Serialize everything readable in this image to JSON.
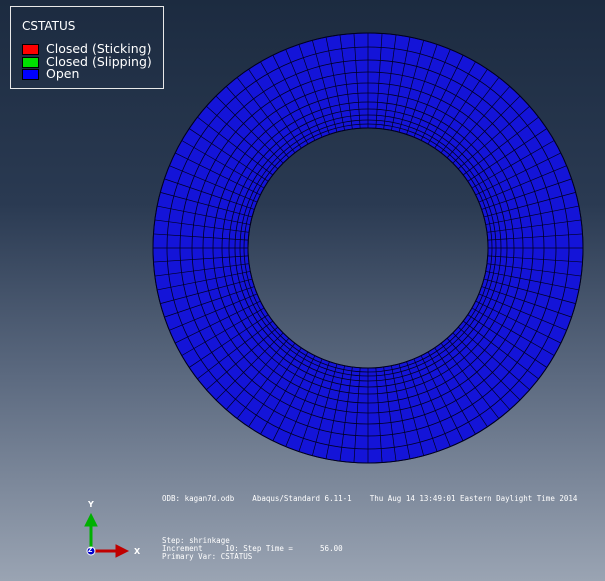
{
  "legend": {
    "title": "CSTATUS",
    "items": [
      {
        "label": "Closed (Sticking)",
        "color": "#ff0000"
      },
      {
        "label": "Closed (Slipping)",
        "color": "#00e000"
      },
      {
        "label": "Open",
        "color": "#0000ff"
      }
    ]
  },
  "model": {
    "fill_color": "#1414d8",
    "mesh_color": "#000020"
  },
  "info": {
    "odb_line": "ODB: kagan7d.odb    Abaqus/Standard 6.11-1    Thu Aug 14 13:49:01 Eastern Daylight Time 2014",
    "step_line": "Step: shrinkage",
    "increment_line": "Increment     10: Step Time =      56.00",
    "primary_var_line": "Primary Var: CSTATUS"
  },
  "triad": {
    "x_label": "X",
    "y_label": "Y",
    "z_label": "Z",
    "x_color": "#c00000",
    "y_color": "#00b000",
    "z_color": "#0000cc"
  }
}
